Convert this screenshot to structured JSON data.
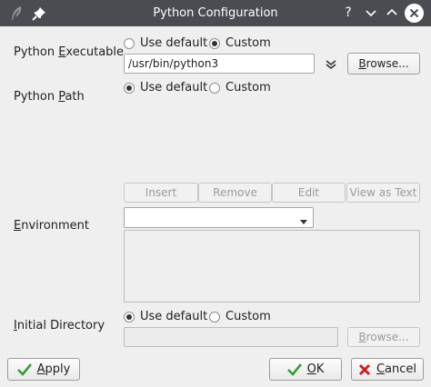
{
  "window": {
    "title": "Python Configuration",
    "help_glyph": "?",
    "minimize_glyph": "∨",
    "maximize_glyph": "∧"
  },
  "python_executable": {
    "label_pre": "Python ",
    "label_mn": "E",
    "label_post": "xecutable",
    "use_default_label": "Use default",
    "custom_label": "Custom",
    "selected": "custom",
    "path_value": "/usr/bin/python3",
    "browse_label_mn": "B",
    "browse_label_post": "rowse..."
  },
  "python_path": {
    "label_pre": "Python ",
    "label_mn": "P",
    "label_post": "ath",
    "use_default_label": "Use default",
    "custom_label": "Custom",
    "selected": "use_default",
    "buttons": [
      "Insert",
      "Remove",
      "Edit",
      "View as Text"
    ]
  },
  "environment": {
    "label_pre": "",
    "label_mn": "E",
    "label_post": "nvironment",
    "combo_value": ""
  },
  "initial_directory": {
    "label_pre": "",
    "label_mn": "I",
    "label_post": "nitial Directory",
    "use_default_label": "Use default",
    "custom_label": "Custom",
    "selected": "use_default",
    "path_value": "",
    "browse_label_mn": "B",
    "browse_label_post": "rowse..."
  },
  "footer": {
    "apply_mn": "A",
    "apply_post": "pply",
    "ok_mn": "O",
    "ok_post": "K",
    "cancel_mn": "C",
    "cancel_post": "ancel"
  },
  "colors": {
    "titlebar": "#4a4c51",
    "check_green": "#3a9a3a",
    "cancel_red": "#cc1f1f"
  }
}
